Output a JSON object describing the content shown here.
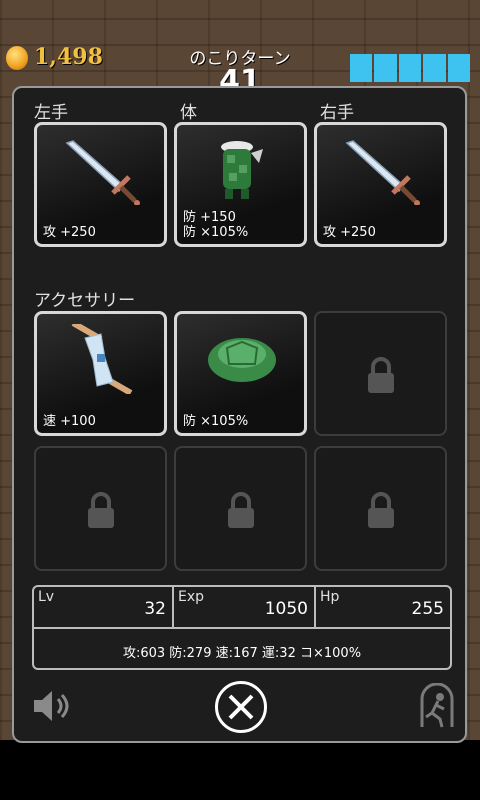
{
  "hud": {
    "coins": "1,498",
    "turns_label": "のこりターン",
    "turns_value": "41"
  },
  "colors": {
    "hp_bar": "#3ec3f0",
    "coin_text": "#f2c040"
  },
  "equipment": {
    "left_hand": {
      "label": "左手",
      "item_icon": "sword-icon",
      "stats": [
        "攻 +250"
      ]
    },
    "body": {
      "label": "体",
      "item_icon": "turtle-armor-icon",
      "stats": [
        "防 +150",
        "防 ×105%"
      ]
    },
    "right_hand": {
      "label": "右手",
      "item_icon": "sword-icon",
      "stats": [
        "攻 +250"
      ]
    }
  },
  "accessories": {
    "label": "アクセサリー",
    "slots": [
      {
        "item_icon": "hourglass-icon",
        "stats": [
          "速 +100"
        ]
      },
      {
        "item_icon": "turtle-shell-icon",
        "stats": [
          "防 ×105%"
        ]
      },
      {
        "item_icon": "lock-icon"
      },
      {
        "item_icon": "lock-icon"
      },
      {
        "item_icon": "lock-icon"
      },
      {
        "item_icon": "lock-icon"
      }
    ]
  },
  "stats": {
    "lv_label": "Lv",
    "lv": "32",
    "exp_label": "Exp",
    "exp": "1050",
    "hp_label": "Hp",
    "hp": "255",
    "summary": "攻:603  防:279  速:167  運:32  コ×100%"
  },
  "controls": {
    "sound": "speaker-icon",
    "close": "close-icon",
    "escape": "escape-icon"
  }
}
